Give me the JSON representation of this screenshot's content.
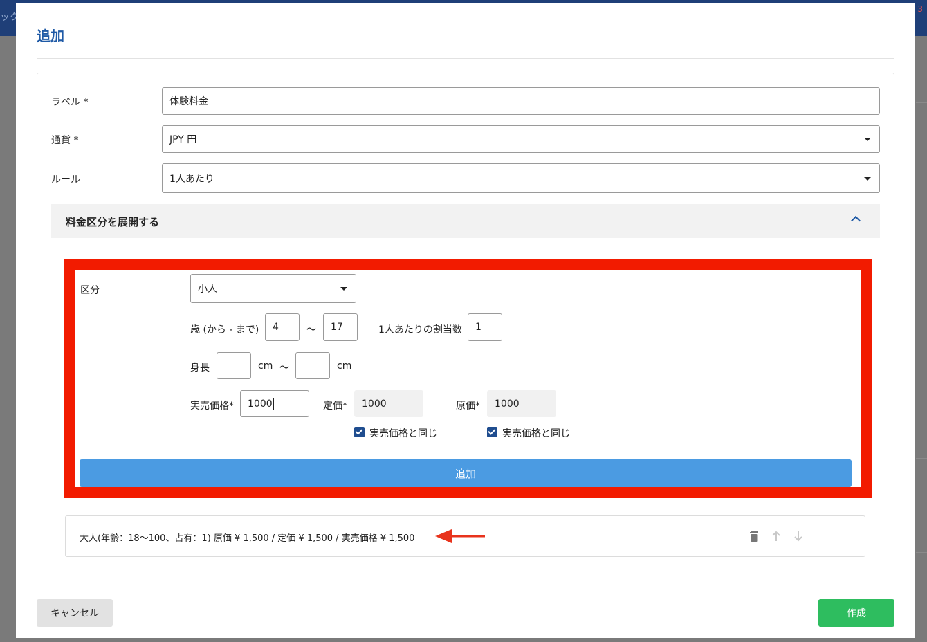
{
  "background": {
    "topbar_text": "ック",
    "badge": "3"
  },
  "modal": {
    "title": "追加"
  },
  "form": {
    "label": {
      "caption": "ラベル *",
      "value": "体験料金"
    },
    "currency": {
      "caption": "通貨 *",
      "value": "JPY 円"
    },
    "rule": {
      "caption": "ルール",
      "value": "1人あたり"
    },
    "accordion_title": "料金区分を展開する"
  },
  "category_form": {
    "category_caption": "区分",
    "category_value": "小人",
    "age_caption": "歳 (から - まで)",
    "age_from": "4",
    "tilde": "〜",
    "age_to": "17",
    "allotment_caption": "1人あたりの割当数",
    "allotment_value": "1",
    "height_caption": "身長",
    "height_from": "",
    "height_to": "",
    "unit_cm": "cm",
    "actual_price_caption": "実売価格*",
    "actual_price_value": "1000",
    "list_price_caption": "定価*",
    "list_price_value": "1000",
    "cost_price_caption": "原価*",
    "cost_price_value": "1000",
    "same_as_actual_label": "実売価格と同じ",
    "list_price_same_checked": true,
    "cost_price_same_checked": true,
    "add_button": "追加"
  },
  "result_list": [
    {
      "text": "大人(年齢：18〜100、占有：1) 原価 ¥ 1,500 / 定価 ¥ 1,500 / 実売価格 ¥ 1,500"
    }
  ],
  "footer": {
    "cancel": "キャンセル",
    "create": "作成"
  },
  "colors": {
    "highlight": "#f21b00",
    "primary_button": "#4b9be2",
    "create_button": "#2ebd5f",
    "title": "#1f5aa6"
  }
}
